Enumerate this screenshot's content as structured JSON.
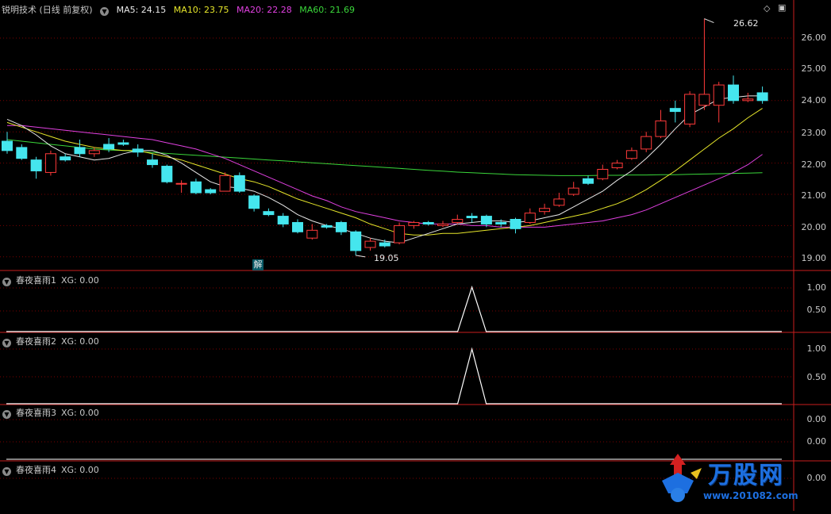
{
  "main_panel": {
    "indicator_name": "锐明技术 (日线 前复权)",
    "ma": [
      {
        "label": "MA5: 24.15",
        "color": "#e8e8e8"
      },
      {
        "label": "MA10: 23.75",
        "color": "#e6e62a"
      },
      {
        "label": "MA20: 22.28",
        "color": "#e040e0"
      },
      {
        "label": "MA60: 21.69",
        "color": "#3ad63a"
      }
    ],
    "y_ticks": [
      "26.00",
      "25.00",
      "24.00",
      "23.00",
      "22.00",
      "21.00",
      "20.00",
      "19.00"
    ],
    "high_label": "26.62",
    "low_label": "19.05",
    "badge": "解"
  },
  "sub_panels": [
    {
      "title": "春夜喜雨1",
      "value": "XG: 0.00",
      "ticks": [
        "1.00",
        "0.50"
      ]
    },
    {
      "title": "春夜喜雨2",
      "value": "XG: 0.00",
      "ticks": [
        "1.00",
        "0.50"
      ]
    },
    {
      "title": "春夜喜雨3",
      "value": "XG: 0.00",
      "ticks": [
        "0.00",
        "0.00"
      ]
    },
    {
      "title": "春夜喜雨4",
      "value": "XG: 0.00",
      "ticks": [
        "0.00"
      ]
    }
  ],
  "watermark": {
    "brand": "万股网",
    "url": "www.201082.com"
  },
  "colors": {
    "up": "#ff3a3a",
    "down": "#45e6ee",
    "grid": "#7a0000",
    "separator": "#c81e1e"
  },
  "chart_data": {
    "type": "candlestick",
    "ylim": [
      18.85,
      26.9
    ],
    "candles": [
      [
        22.7,
        22.4,
        23.0,
        22.3
      ],
      [
        22.5,
        22.15,
        22.6,
        22.1
      ],
      [
        22.1,
        21.75,
        22.2,
        21.5
      ],
      [
        21.7,
        22.3,
        22.4,
        21.6
      ],
      [
        22.2,
        22.1,
        22.3,
        22.05
      ],
      [
        22.5,
        22.3,
        22.75,
        22.2
      ],
      [
        22.3,
        22.4,
        22.5,
        22.2
      ],
      [
        22.6,
        22.45,
        22.8,
        22.35
      ],
      [
        22.65,
        22.6,
        22.75,
        22.55
      ],
      [
        22.45,
        22.35,
        22.6,
        22.2
      ],
      [
        22.1,
        21.95,
        22.3,
        21.85
      ],
      [
        21.9,
        21.4,
        21.95,
        21.35
      ],
      [
        21.35,
        21.35,
        21.45,
        21.05
      ],
      [
        21.4,
        21.05,
        21.5,
        21.0
      ],
      [
        21.15,
        21.05,
        21.2,
        21.0
      ],
      [
        21.1,
        21.6,
        21.7,
        21.1
      ],
      [
        21.6,
        21.1,
        21.7,
        21.05
      ],
      [
        20.95,
        20.55,
        21.0,
        20.45
      ],
      [
        20.45,
        20.35,
        20.55,
        20.3
      ],
      [
        20.3,
        20.05,
        20.4,
        19.95
      ],
      [
        20.1,
        19.8,
        20.2,
        19.75
      ],
      [
        19.6,
        19.85,
        20.05,
        19.55
      ],
      [
        20.0,
        19.95,
        20.05,
        19.9
      ],
      [
        20.1,
        19.8,
        20.15,
        19.7
      ],
      [
        19.8,
        19.2,
        19.85,
        19.05
      ],
      [
        19.3,
        19.5,
        19.6,
        19.2
      ],
      [
        19.45,
        19.35,
        19.55,
        19.3
      ],
      [
        19.45,
        20.0,
        20.1,
        19.4
      ],
      [
        20.0,
        20.1,
        20.15,
        19.9
      ],
      [
        20.1,
        20.05,
        20.15,
        20.0
      ],
      [
        20.0,
        20.05,
        20.15,
        19.95
      ],
      [
        20.1,
        20.2,
        20.35,
        20.05
      ],
      [
        20.3,
        20.25,
        20.4,
        20.1
      ],
      [
        20.3,
        20.05,
        20.35,
        19.95
      ],
      [
        20.1,
        20.05,
        20.2,
        19.95
      ],
      [
        20.2,
        19.9,
        20.25,
        19.75
      ],
      [
        20.1,
        20.4,
        20.55,
        20.05
      ],
      [
        20.45,
        20.55,
        20.7,
        20.35
      ],
      [
        20.65,
        20.85,
        21.05,
        20.6
      ],
      [
        21.0,
        21.2,
        21.4,
        20.95
      ],
      [
        21.5,
        21.35,
        21.6,
        21.3
      ],
      [
        21.5,
        21.8,
        21.95,
        21.45
      ],
      [
        21.85,
        22.0,
        22.1,
        21.8
      ],
      [
        22.15,
        22.4,
        22.5,
        22.1
      ],
      [
        22.45,
        22.85,
        23.0,
        22.35
      ],
      [
        22.85,
        23.35,
        23.7,
        22.8
      ],
      [
        23.75,
        23.65,
        24.0,
        23.3
      ],
      [
        23.25,
        24.2,
        24.3,
        23.15
      ],
      [
        23.85,
        24.2,
        26.62,
        23.7
      ],
      [
        23.85,
        24.5,
        24.6,
        23.3
      ],
      [
        24.5,
        24.0,
        24.8,
        23.9
      ],
      [
        24.0,
        24.05,
        24.25,
        23.95
      ],
      [
        24.25,
        24.0,
        24.45,
        23.9
      ]
    ],
    "ma5": [
      23.4,
      23.2,
      22.9,
      22.55,
      22.3,
      22.2,
      22.1,
      22.15,
      22.3,
      22.4,
      22.4,
      22.25,
      22.0,
      21.7,
      21.4,
      21.25,
      21.2,
      21.1,
      20.9,
      20.65,
      20.35,
      20.15,
      20.0,
      19.9,
      19.75,
      19.6,
      19.5,
      19.45,
      19.6,
      19.75,
      19.9,
      20.05,
      20.1,
      20.15,
      20.15,
      20.1,
      20.15,
      20.25,
      20.35,
      20.6,
      20.85,
      21.1,
      21.45,
      21.75,
      22.15,
      22.6,
      23.1,
      23.55,
      23.8,
      24.05,
      24.1,
      24.15,
      24.15
    ],
    "ma10": [
      23.3,
      23.15,
      23.0,
      22.85,
      22.7,
      22.6,
      22.5,
      22.45,
      22.4,
      22.4,
      22.3,
      22.2,
      22.1,
      21.95,
      21.8,
      21.65,
      21.5,
      21.4,
      21.25,
      21.05,
      20.85,
      20.7,
      20.55,
      20.4,
      20.25,
      20.05,
      19.9,
      19.75,
      19.7,
      19.7,
      19.75,
      19.75,
      19.8,
      19.85,
      19.9,
      19.95,
      20.0,
      20.1,
      20.2,
      20.3,
      20.4,
      20.55,
      20.7,
      20.9,
      21.15,
      21.45,
      21.75,
      22.1,
      22.45,
      22.8,
      23.1,
      23.45,
      23.75
    ],
    "ma20": [
      23.2,
      23.2,
      23.15,
      23.1,
      23.05,
      23.0,
      22.95,
      22.9,
      22.85,
      22.8,
      22.75,
      22.65,
      22.55,
      22.45,
      22.3,
      22.15,
      21.95,
      21.75,
      21.55,
      21.35,
      21.15,
      20.95,
      20.8,
      20.6,
      20.45,
      20.35,
      20.25,
      20.15,
      20.1,
      20.05,
      20.05,
      20.05,
      20.0,
      20.0,
      19.95,
      19.95,
      19.95,
      19.95,
      20.0,
      20.05,
      20.1,
      20.15,
      20.25,
      20.35,
      20.5,
      20.7,
      20.9,
      21.1,
      21.3,
      21.5,
      21.7,
      21.95,
      22.28
    ],
    "ma60": [
      22.75,
      22.7,
      22.65,
      22.6,
      22.55,
      22.5,
      22.45,
      22.42,
      22.4,
      22.37,
      22.34,
      22.31,
      22.28,
      22.25,
      22.22,
      22.19,
      22.16,
      22.13,
      22.1,
      22.07,
      22.04,
      22.01,
      21.98,
      21.95,
      21.92,
      21.89,
      21.86,
      21.83,
      21.8,
      21.77,
      21.74,
      21.71,
      21.69,
      21.67,
      21.65,
      21.63,
      21.62,
      21.61,
      21.6,
      21.6,
      21.6,
      21.61,
      21.61,
      21.62,
      21.62,
      21.63,
      21.63,
      21.64,
      21.65,
      21.66,
      21.67,
      21.68,
      21.69
    ],
    "signal_spike_index": 32
  }
}
